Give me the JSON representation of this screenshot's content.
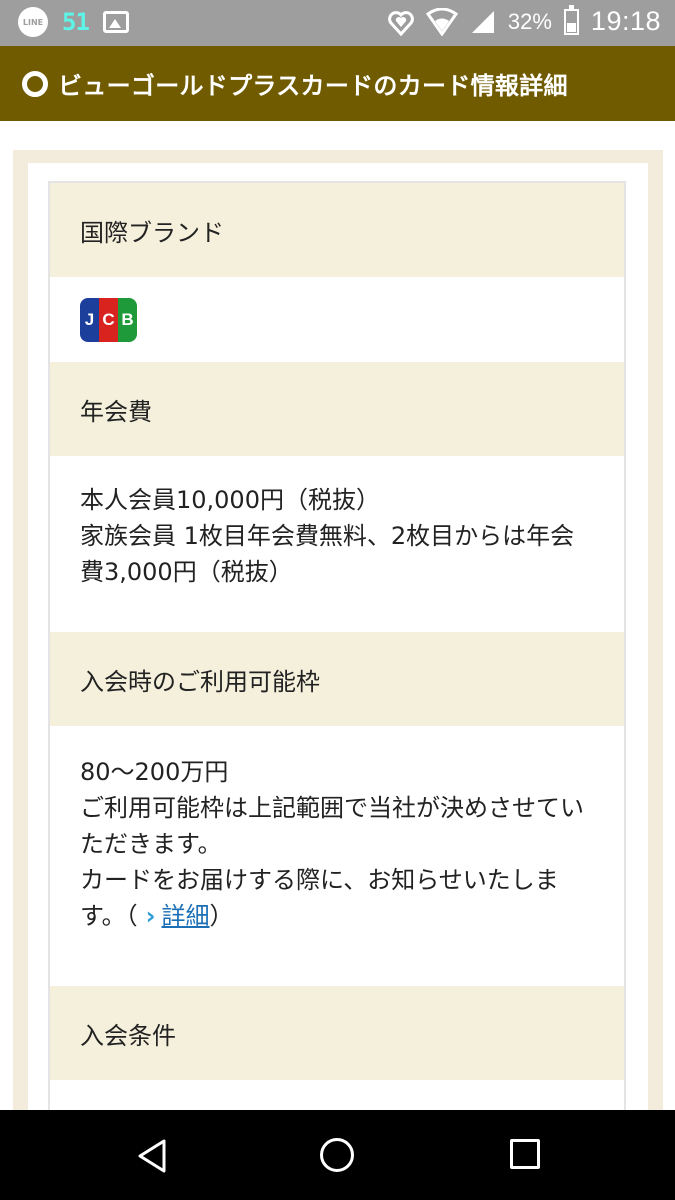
{
  "status_bar": {
    "line_label": "LINE",
    "notification_count": "51",
    "battery_percent": "32%",
    "battery_level": 0.32,
    "time": "19:18"
  },
  "header": {
    "title": "ビューゴールドプラスカードのカード情報詳細"
  },
  "sections": {
    "brand": {
      "heading": "国際ブランド",
      "logo_letters": [
        "J",
        "C",
        "B"
      ]
    },
    "annual_fee": {
      "heading": "年会費",
      "lines": [
        "本人会員10,000円（税抜）",
        "家族会員 1枚目年会費無料、2枚目からは年会費3,000円（税抜）"
      ]
    },
    "credit_limit": {
      "heading": "入会時のご利用可能枠",
      "lines": [
        "80〜200万円",
        "ご利用可能枠は上記範囲で当社が決めさせていただきます。",
        "カードをお届けする際に、お知らせいたします。（"
      ],
      "link_label": "詳細",
      "close_paren": "）"
    },
    "conditions": {
      "heading": "入会条件"
    }
  },
  "nav_bar": {
    "back_icon": "triangle-back-icon",
    "home_icon": "circle-home-icon",
    "recent_icon": "square-recent-icon"
  }
}
